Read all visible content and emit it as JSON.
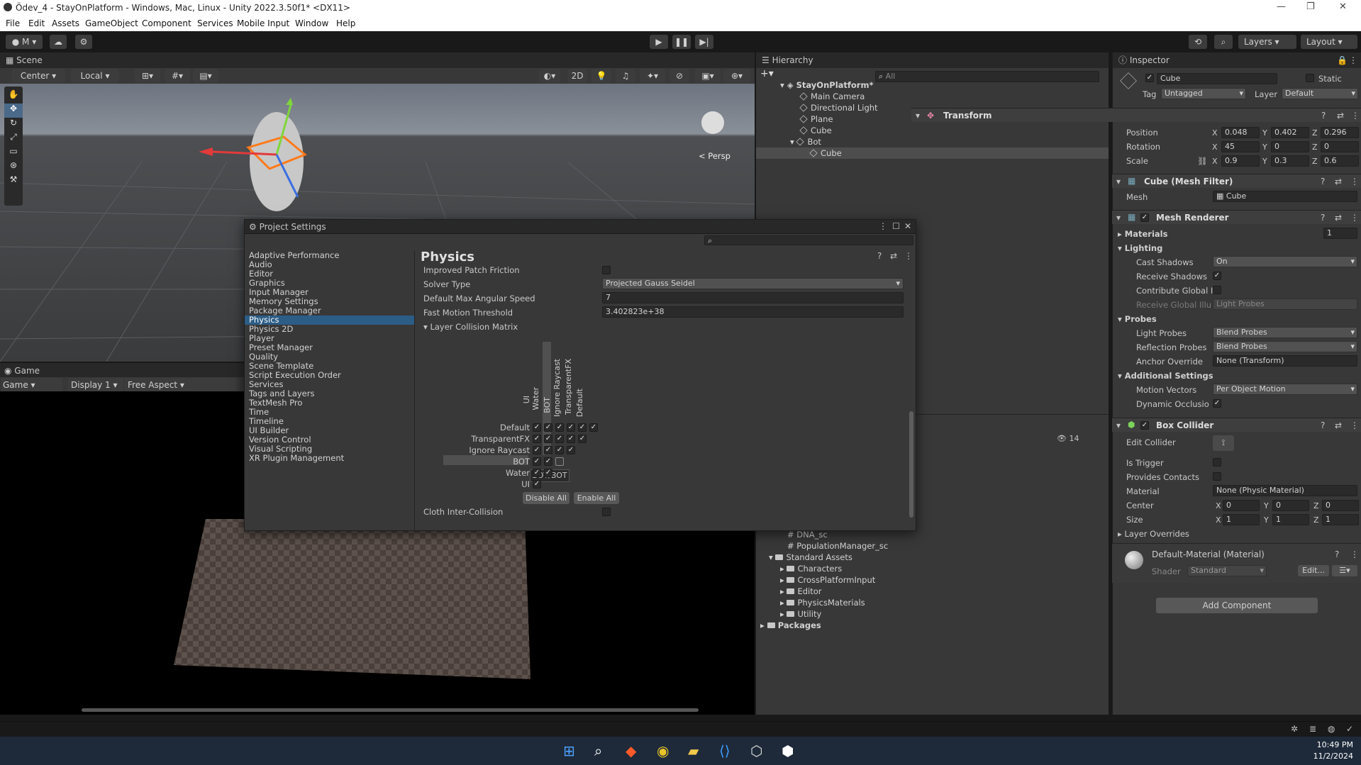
{
  "window": {
    "title": "Ödev_4 - StayOnPlatform - Windows, Mac, Linux - Unity 2022.3.50f1* <DX11>",
    "min": "—",
    "max": "❐",
    "close": "✕"
  },
  "menu": [
    "File",
    "Edit",
    "Assets",
    "GameObject",
    "Component",
    "Services",
    "Mobile Input",
    "Window",
    "Help"
  ],
  "toolbar": {
    "account": "M",
    "layers": "Layers",
    "layout": "Layout"
  },
  "scene": {
    "tab": "Scene",
    "pivot": "Center",
    "space": "Local",
    "mode2d": "2D",
    "persp": "< Persp"
  },
  "game": {
    "tab": "Game",
    "mode": "Game",
    "display": "Display 1",
    "aspect": "Free Aspect"
  },
  "hierarchy": {
    "tab": "Hierarchy",
    "search_placeholder": "All",
    "scene_name": "StayOnPlatform*",
    "items": [
      "Main Camera",
      "Directional Light",
      "Plane",
      "Cube",
      "Bot",
      "Cube"
    ]
  },
  "project": {
    "count": "14",
    "items": [
      "DNA_sc",
      "PopulationManager_sc",
      "Standard Assets",
      "Characters",
      "CrossPlatformInput",
      "Editor",
      "PhysicsMaterials",
      "Utility",
      "Packages"
    ]
  },
  "project_settings": {
    "title": "Project Settings",
    "categories": [
      "Adaptive Performance",
      "Audio",
      "Editor",
      "Graphics",
      "Input Manager",
      "Memory Settings",
      "Package Manager",
      "Physics",
      "Physics 2D",
      "Player",
      "Preset Manager",
      "Quality",
      "Scene Template",
      "Script Execution Order",
      "Services",
      "Tags and Layers",
      "TextMesh Pro",
      "Time",
      "Timeline",
      "UI Builder",
      "Version Control",
      "Visual Scripting",
      "XR Plugin Management"
    ],
    "selected": "Physics",
    "heading": "Physics",
    "improved_patch_friction": "Improved Patch Friction",
    "solver_type_label": "Solver Type",
    "solver_type": "Projected Gauss Seidel",
    "max_angular_label": "Default Max Angular Speed",
    "max_angular": "7",
    "fast_motion_label": "Fast Motion Threshold",
    "fast_motion": "3.402823e+38",
    "matrix_label": "Layer Collision Matrix",
    "matrix_columns": [
      "UI",
      "Water",
      "BOT",
      "Ignore Raycast",
      "TransparentFX",
      "Default"
    ],
    "matrix_rows": [
      "Default",
      "TransparentFX",
      "Ignore Raycast",
      "BOT",
      "Water",
      "UI"
    ],
    "tooltip": "BOT/BOT",
    "disable_all": "Disable All",
    "enable_all": "Enable All",
    "cloth": "Cloth Inter-Collision"
  },
  "inspector": {
    "tab": "Inspector",
    "object_name": "Cube",
    "static_label": "Static",
    "tag_label": "Tag",
    "tag": "Untagged",
    "layer_label": "Layer",
    "layer": "Default",
    "transform": {
      "title": "Transform",
      "position_label": "Position",
      "px": "0.048",
      "py": "0.402",
      "pz": "0.296",
      "rotation_label": "Rotation",
      "rx": "45",
      "ry": "0",
      "rz": "0",
      "scale_label": "Scale",
      "sx": "0.9",
      "sy": "0.3",
      "sz": "0.6"
    },
    "mesh_filter": {
      "title": "Cube (Mesh Filter)",
      "mesh_label": "Mesh",
      "mesh": "Cube"
    },
    "mesh_renderer": {
      "title": "Mesh Renderer",
      "materials_label": "Materials",
      "materials_count": "1",
      "lighting": "Lighting",
      "cast_shadows_label": "Cast Shadows",
      "cast_shadows": "On",
      "receive_shadows_label": "Receive Shadows",
      "contribute_gi_label": "Contribute Global I",
      "receive_gi_label": "Receive Global Illu",
      "receive_gi": "Light Probes",
      "probes": "Probes",
      "light_probes_label": "Light Probes",
      "light_probes": "Blend Probes",
      "reflection_probes_label": "Reflection Probes",
      "reflection_probes": "Blend Probes",
      "anchor_label": "Anchor Override",
      "anchor": "None (Transform)",
      "additional": "Additional Settings",
      "motion_vectors_label": "Motion Vectors",
      "motion_vectors": "Per Object Motion",
      "dynamic_occlusion_label": "Dynamic Occlusio"
    },
    "box_collider": {
      "title": "Box Collider",
      "edit_collider_label": "Edit Collider",
      "is_trigger_label": "Is Trigger",
      "provides_contacts_label": "Provides Contacts",
      "material_label": "Material",
      "material": "None (Physic Material)",
      "center_label": "Center",
      "cx": "0",
      "cy": "0",
      "cz": "0",
      "size_label": "Size",
      "szx": "1",
      "szy": "1",
      "szz": "1",
      "layer_overrides": "Layer Overrides"
    },
    "material": {
      "title": "Default-Material (Material)",
      "shader_label": "Shader",
      "shader": "Standard",
      "edit": "Edit..."
    },
    "add_component": "Add Component"
  },
  "taskbar": {
    "time": "10:49 PM",
    "date": "11/2/2024"
  },
  "colors": {
    "accent": "#2c5d87",
    "panel": "#383838",
    "dark": "#191919"
  }
}
